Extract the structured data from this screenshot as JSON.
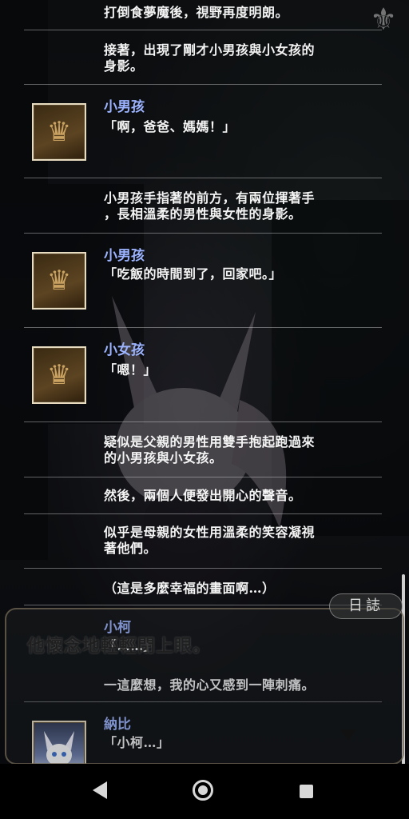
{
  "log": {
    "entries": [
      {
        "speaker": "",
        "text": "打倒食夢魔後，視野再度明朗。"
      },
      {
        "speaker": "",
        "text": "接著，出現了剛才小男孩與小女孩的\n身影。"
      },
      {
        "speaker": "小男孩",
        "text": "「啊，爸爸、媽媽！」"
      },
      {
        "speaker": "",
        "text": "小男孩手指著的前方，有兩位揮著手\n，長相溫柔的男性與女性的身影。"
      },
      {
        "speaker": "小男孩",
        "text": "「吃飯的時間到了，回家吧。」"
      },
      {
        "speaker": "小女孩",
        "text": "「嗯！」"
      },
      {
        "speaker": "",
        "text": "疑似是父親的男性用雙手抱起跑過來\n的小男孩與小女孩。"
      },
      {
        "speaker": "",
        "text": "然後，兩個人便發出開心的聲音。"
      },
      {
        "speaker": "",
        "text": "似乎是母親的女性用溫柔的笑容凝視\n著他們。"
      },
      {
        "speaker": "",
        "text": "（這是多麼幸福的畫面啊…）"
      },
      {
        "speaker": "小柯",
        "text": "「……」"
      },
      {
        "speaker": "",
        "text": "一這麼想，我的心又感到一陣刺痛。"
      },
      {
        "speaker": "納比",
        "text": "「小柯…」"
      }
    ]
  },
  "dialog": {
    "text": "他懷念地輕輕閉上眼。",
    "log_button": "日誌"
  },
  "icons": {
    "fleur": "fleur-de-lis-icon",
    "crown": "crown-icon"
  }
}
